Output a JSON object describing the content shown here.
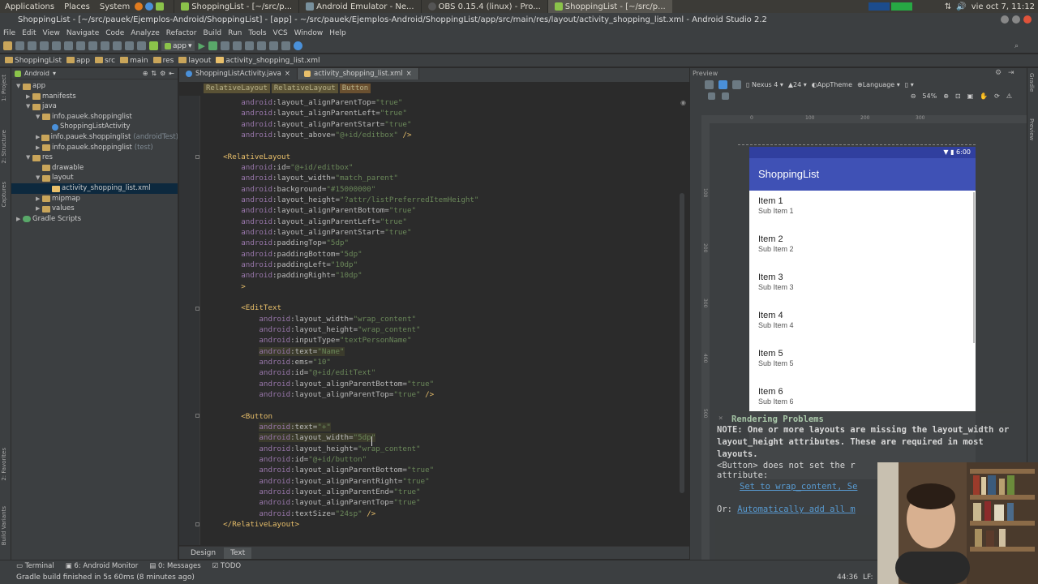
{
  "os": {
    "menus": [
      "Applications",
      "Places",
      "System"
    ],
    "tasks": [
      {
        "label": "ShoppingList - [~/src/p...",
        "active": false
      },
      {
        "label": "Android Emulator - Ne...",
        "active": false
      },
      {
        "label": "OBS 0.15.4 (linux) - Pro...",
        "active": false
      },
      {
        "label": "ShoppingList - [~/src/p...",
        "active": true
      }
    ],
    "clock": "vie oct 7, 11:12"
  },
  "window": {
    "title": "ShoppingList - [~/src/pauek/Ejemplos-Android/ShoppingList] - [app] - ~/src/pauek/Ejemplos-Android/ShoppingList/app/src/main/res/layout/activity_shopping_list.xml - Android Studio 2.2"
  },
  "menubar": [
    "File",
    "Edit",
    "View",
    "Navigate",
    "Code",
    "Analyze",
    "Refactor",
    "Build",
    "Run",
    "Tools",
    "VCS",
    "Window",
    "Help"
  ],
  "toolbar": {
    "run_config": "app"
  },
  "navbar": [
    "ShoppingList",
    "app",
    "src",
    "main",
    "res",
    "layout",
    "activity_shopping_list.xml"
  ],
  "left_strip": [
    "1: Project",
    "2: Structure",
    "Captures",
    "2: Favorites",
    "Build Variants"
  ],
  "project": {
    "view_mode": "Android",
    "tree": [
      {
        "label": "app",
        "depth": 0,
        "arrow": "▼"
      },
      {
        "label": "manifests",
        "depth": 1,
        "arrow": "▶"
      },
      {
        "label": "java",
        "depth": 1,
        "arrow": "▼"
      },
      {
        "label": "info.pauek.shoppinglist",
        "depth": 2,
        "arrow": "▼"
      },
      {
        "label": "ShoppingListActivity",
        "depth": 3,
        "arrow": ""
      },
      {
        "label": "info.pauek.shoppinglist",
        "depth": 2,
        "arrow": "▶",
        "suffix": "(androidTest)"
      },
      {
        "label": "info.pauek.shoppinglist",
        "depth": 2,
        "arrow": "▶",
        "suffix": "(test)"
      },
      {
        "label": "res",
        "depth": 1,
        "arrow": "▼"
      },
      {
        "label": "drawable",
        "depth": 2,
        "arrow": ""
      },
      {
        "label": "layout",
        "depth": 2,
        "arrow": "▼"
      },
      {
        "label": "activity_shopping_list.xml",
        "depth": 3,
        "arrow": "",
        "selected": true
      },
      {
        "label": "mipmap",
        "depth": 2,
        "arrow": "▶"
      },
      {
        "label": "values",
        "depth": 2,
        "arrow": "▶"
      },
      {
        "label": "Gradle Scripts",
        "depth": 0,
        "arrow": "▶"
      }
    ]
  },
  "editor": {
    "tabs": [
      {
        "label": "ShoppingListActivity.java",
        "active": false
      },
      {
        "label": "activity_shopping_list.xml",
        "active": true
      }
    ],
    "breadcrumbs": [
      "RelativeLayout",
      "RelativeLayout",
      "Button"
    ],
    "lines": [
      {
        "i": 2,
        "t": "attr",
        "n": "layout_alignParentTop",
        "v": "\"true\""
      },
      {
        "i": 2,
        "t": "attr",
        "n": "layout_alignParentLeft",
        "v": "\"true\""
      },
      {
        "i": 2,
        "t": "attr",
        "n": "layout_alignParentStart",
        "v": "\"true\""
      },
      {
        "i": 2,
        "t": "attr",
        "n": "layout_above",
        "v": "\"@+id/editbox\"",
        "end": " />"
      },
      {
        "i": 0,
        "t": "blank"
      },
      {
        "i": 1,
        "t": "tag",
        "text": "<RelativeLayout"
      },
      {
        "i": 2,
        "t": "attr",
        "n": "id",
        "v": "\"@+id/editbox\""
      },
      {
        "i": 2,
        "t": "attr",
        "n": "layout_width",
        "v": "\"match_parent\""
      },
      {
        "i": 2,
        "t": "attr",
        "n": "background",
        "v": "\"#15000000\""
      },
      {
        "i": 2,
        "t": "attr",
        "n": "layout_height",
        "v": "\"?attr/listPreferredItemHeight\""
      },
      {
        "i": 2,
        "t": "attr",
        "n": "layout_alignParentBottom",
        "v": "\"true\""
      },
      {
        "i": 2,
        "t": "attr",
        "n": "layout_alignParentLeft",
        "v": "\"true\""
      },
      {
        "i": 2,
        "t": "attr",
        "n": "layout_alignParentStart",
        "v": "\"true\""
      },
      {
        "i": 2,
        "t": "attr",
        "n": "paddingTop",
        "v": "\"5dp\""
      },
      {
        "i": 2,
        "t": "attr",
        "n": "paddingBottom",
        "v": "\"5dp\""
      },
      {
        "i": 2,
        "t": "attr",
        "n": "paddingLeft",
        "v": "\"10dp\""
      },
      {
        "i": 2,
        "t": "attr",
        "n": "paddingRight",
        "v": "\"10dp\""
      },
      {
        "i": 2,
        "t": "tag",
        "text": ">"
      },
      {
        "i": 0,
        "t": "blank"
      },
      {
        "i": 2,
        "t": "tag",
        "text": "<EditText"
      },
      {
        "i": 3,
        "t": "attr",
        "n": "layout_width",
        "v": "\"wrap_content\""
      },
      {
        "i": 3,
        "t": "attr",
        "n": "layout_height",
        "v": "\"wrap_content\""
      },
      {
        "i": 3,
        "t": "attr",
        "n": "inputType",
        "v": "\"textPersonName\""
      },
      {
        "i": 3,
        "t": "attr",
        "n": "text",
        "v": "\"Name\"",
        "hl": true
      },
      {
        "i": 3,
        "t": "attr",
        "n": "ems",
        "v": "\"10\""
      },
      {
        "i": 3,
        "t": "attr",
        "n": "id",
        "v": "\"@+id/editText\""
      },
      {
        "i": 3,
        "t": "attr",
        "n": "layout_alignParentBottom",
        "v": "\"true\""
      },
      {
        "i": 3,
        "t": "attr",
        "n": "layout_alignParentTop",
        "v": "\"true\"",
        "end": " />"
      },
      {
        "i": 0,
        "t": "blank"
      },
      {
        "i": 2,
        "t": "tag",
        "text": "<Button"
      },
      {
        "i": 3,
        "t": "attr",
        "n": "text",
        "v": "\"+\"",
        "hl": true
      },
      {
        "i": 3,
        "t": "attr",
        "n": "layout_width",
        "v": "\"5dp\"",
        "hl": true
      },
      {
        "i": 3,
        "t": "attr",
        "n": "layout_height",
        "v": "\"wrap_content\""
      },
      {
        "i": 3,
        "t": "attr",
        "n": "id",
        "v": "\"@+id/button\""
      },
      {
        "i": 3,
        "t": "attr",
        "n": "layout_alignParentBottom",
        "v": "\"true\""
      },
      {
        "i": 3,
        "t": "attr",
        "n": "layout_alignParentRight",
        "v": "\"true\""
      },
      {
        "i": 3,
        "t": "attr",
        "n": "layout_alignParentEnd",
        "v": "\"true\""
      },
      {
        "i": 3,
        "t": "attr",
        "n": "layout_alignParentTop",
        "v": "\"true\""
      },
      {
        "i": 3,
        "t": "attr",
        "n": "textSize",
        "v": "\"24sp\"",
        "end": " />"
      },
      {
        "i": 1,
        "t": "tag",
        "text": "</RelativeLayout>"
      }
    ],
    "bottom_tabs": [
      {
        "label": "Design",
        "active": false
      },
      {
        "label": "Text",
        "active": true
      }
    ]
  },
  "preview": {
    "header": "Preview",
    "device": "Nexus 4",
    "api": "24",
    "theme": "AppTheme",
    "language": "Language",
    "zoom": "54%",
    "ruler_ticks": [
      "0",
      "100",
      "200",
      "300"
    ],
    "ruler_left_ticks": [
      "100",
      "200",
      "300",
      "400",
      "500"
    ],
    "phone": {
      "time": "6:00",
      "app_title": "ShoppingList",
      "items": [
        {
          "title": "Item 1",
          "subtitle": "Sub Item 1"
        },
        {
          "title": "Item 2",
          "subtitle": "Sub Item 2"
        },
        {
          "title": "Item 3",
          "subtitle": "Sub Item 3"
        },
        {
          "title": "Item 4",
          "subtitle": "Sub Item 4"
        },
        {
          "title": "Item 5",
          "subtitle": "Sub Item 5"
        },
        {
          "title": "Item 6",
          "subtitle": "Sub Item 6"
        }
      ]
    },
    "problems": {
      "title": "Rendering Problems",
      "note": "NOTE: One or more layouts are missing the layout_width or layout_height attributes. These are required in most layouts.",
      "message": "<Button> does not set the r",
      "message2": "attribute:",
      "link1": "Set to wrap_content, Se",
      "or_label": "Or: ",
      "link2": "Automatically add all m"
    }
  },
  "right_strip": [
    "Gradle",
    "Preview"
  ],
  "tool_tabs": [
    "Terminal",
    "6: Android Monitor",
    "0: Messages",
    "TODO"
  ],
  "status": {
    "message": "Gradle build finished in 5s 60ms (8 minutes ago)",
    "position": "44:36",
    "line_sep": "LF:"
  },
  "colors": {
    "accent": "#3f51b5",
    "status_bar": "#303f9f",
    "tag": "#e8bf6a",
    "attr": "#9876aa",
    "value": "#6a8759"
  }
}
